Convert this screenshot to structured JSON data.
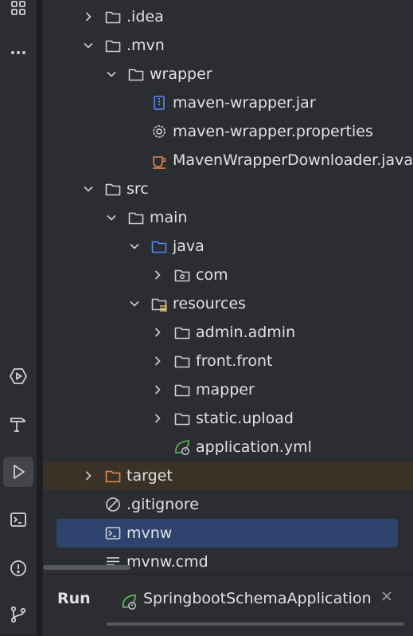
{
  "sidebar": {
    "items": [
      {
        "icon": "structure-icon"
      },
      {
        "icon": "more-icon"
      },
      {
        "icon": "services-icon"
      },
      {
        "icon": "build-icon"
      },
      {
        "icon": "run-icon",
        "active": true
      },
      {
        "icon": "terminal-icon"
      },
      {
        "icon": "problems-icon"
      },
      {
        "icon": "git-icon"
      }
    ]
  },
  "tree": {
    "items": [
      {
        "label": ".idea",
        "level": 0,
        "chevron": "right",
        "icon": "folder-icon"
      },
      {
        "label": ".mvn",
        "level": 0,
        "chevron": "down",
        "icon": "folder-icon"
      },
      {
        "label": "wrapper",
        "level": 1,
        "chevron": "down",
        "icon": "folder-icon"
      },
      {
        "label": "maven-wrapper.jar",
        "level": 2,
        "chevron": "none",
        "icon": "jar-file-icon"
      },
      {
        "label": "maven-wrapper.properties",
        "level": 2,
        "chevron": "none",
        "icon": "gear-icon"
      },
      {
        "label": "MavenWrapperDownloader.java",
        "level": 2,
        "chevron": "none",
        "icon": "java-file-icon"
      },
      {
        "label": "src",
        "level": 0,
        "chevron": "down",
        "icon": "folder-icon"
      },
      {
        "label": "main",
        "level": 1,
        "chevron": "down",
        "icon": "folder-icon"
      },
      {
        "label": "java",
        "level": 2,
        "chevron": "down",
        "icon": "source-folder-icon"
      },
      {
        "label": "com",
        "level": 3,
        "chevron": "right",
        "icon": "package-icon"
      },
      {
        "label": "resources",
        "level": 2,
        "chevron": "down",
        "icon": "resources-folder-icon"
      },
      {
        "label": "admin.admin",
        "level": 3,
        "chevron": "right",
        "icon": "folder-icon"
      },
      {
        "label": "front.front",
        "level": 3,
        "chevron": "right",
        "icon": "folder-icon"
      },
      {
        "label": "mapper",
        "level": 3,
        "chevron": "right",
        "icon": "folder-icon"
      },
      {
        "label": "static.upload",
        "level": 3,
        "chevron": "right",
        "icon": "folder-icon"
      },
      {
        "label": "application.yml",
        "level": 3,
        "chevron": "none",
        "icon": "spring-config-icon"
      },
      {
        "label": "target",
        "level": 0,
        "chevron": "right",
        "icon": "excluded-folder-icon",
        "highlight": true
      },
      {
        "label": ".gitignore",
        "level": 0,
        "chevron": "none",
        "icon": "ignore-file-icon"
      },
      {
        "label": "mvnw",
        "level": 0,
        "chevron": "none",
        "icon": "shell-script-icon",
        "selected": true
      },
      {
        "label": "mvnw.cmd",
        "level": 0,
        "chevron": "none",
        "icon": "text-file-icon"
      }
    ]
  },
  "bottom_panel": {
    "title": "Run",
    "tab": {
      "label": "SpringbootSchemaApplication",
      "icon": "spring-boot-icon"
    }
  },
  "colors": {
    "background": "#2b2d30",
    "selection": "#2e436e",
    "excluded_highlight": "#3a3226",
    "folder_icon": "#ced0d6",
    "source_folder_icon": "#548af7",
    "excluded_folder_icon": "#e08855",
    "spring_icon": "#5fb865",
    "text": "#dfe1e5"
  }
}
